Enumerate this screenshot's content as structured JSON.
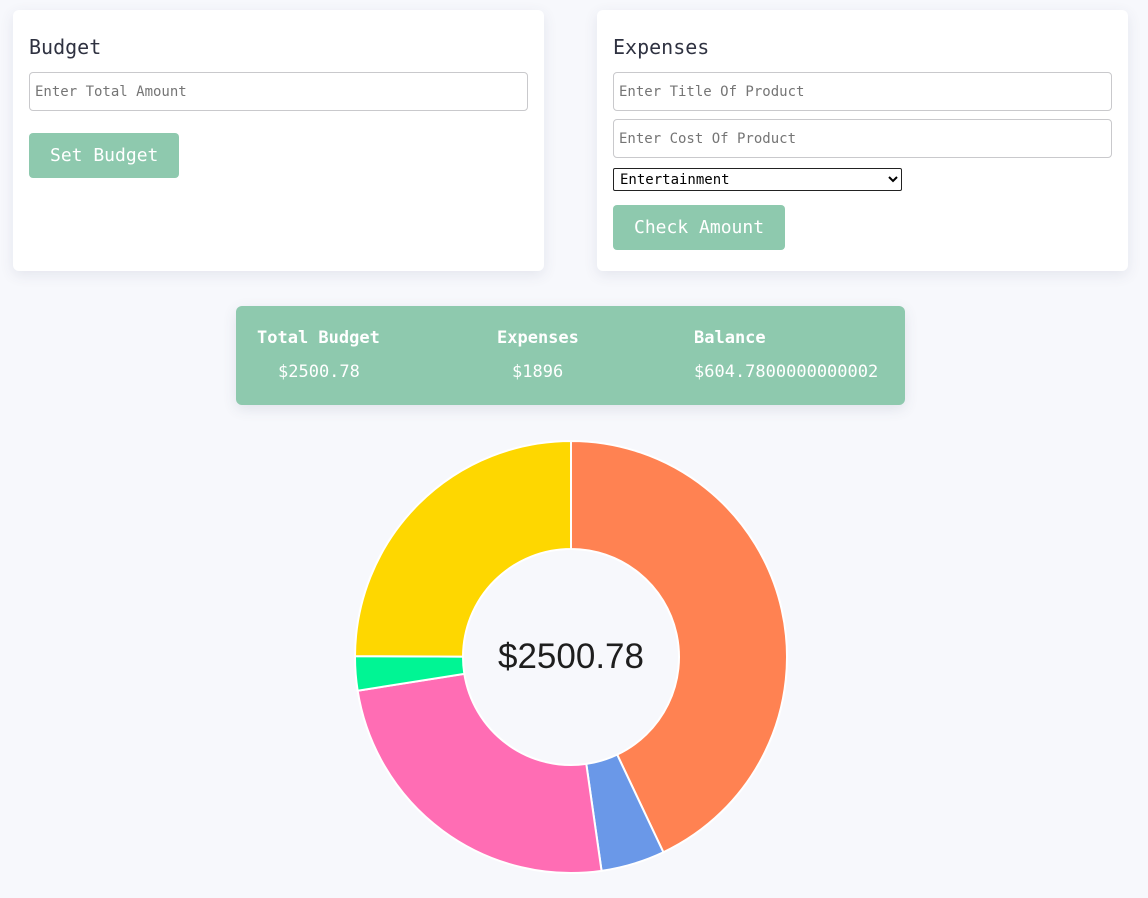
{
  "budget_card": {
    "title": "Budget",
    "amount_input": {
      "value": "",
      "placeholder": "Enter Total Amount"
    },
    "set_budget_label": "Set Budget"
  },
  "expenses_card": {
    "title": "Expenses",
    "title_input": {
      "value": "",
      "placeholder": "Enter Title Of Product"
    },
    "cost_input": {
      "value": "",
      "placeholder": "Enter Cost Of Product"
    },
    "category_selected": "Entertainment",
    "check_amount_label": "Check Amount"
  },
  "summary": {
    "total_budget_label": "Total Budget",
    "total_budget_value": "$2500.78",
    "expenses_label": "Expenses",
    "expenses_value": "$1896",
    "balance_label": "Balance",
    "balance_value": "$604.7800000000002"
  },
  "colors": {
    "accent": "#8ec9ae",
    "card_bg": "#ffffff",
    "page_bg": "#f7f8fc",
    "heading": "#2f3241"
  },
  "chart_data": {
    "type": "pie",
    "center_label": "$2500.78",
    "values": [
      1008,
      112,
      581,
      60,
      585
    ],
    "colors": [
      "#ff8252",
      "#6a98e8",
      "#ff6db4",
      "#00f594",
      "#fed700"
    ],
    "legend": "none"
  }
}
